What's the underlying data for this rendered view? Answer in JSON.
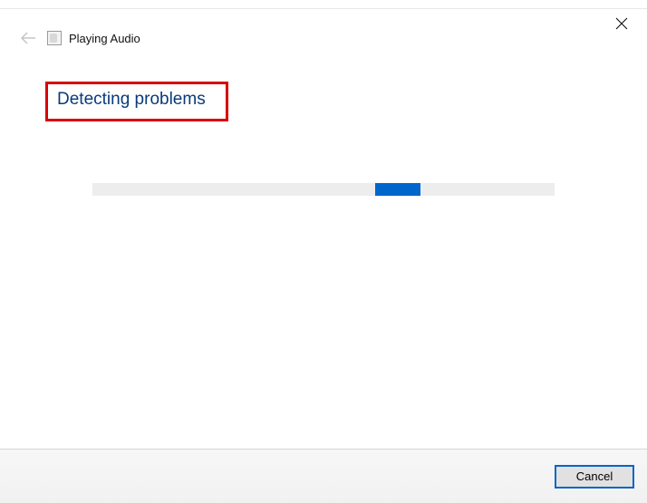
{
  "header": {
    "title": "Playing Audio"
  },
  "main": {
    "status": "Detecting problems"
  },
  "footer": {
    "cancel_label": "Cancel"
  }
}
